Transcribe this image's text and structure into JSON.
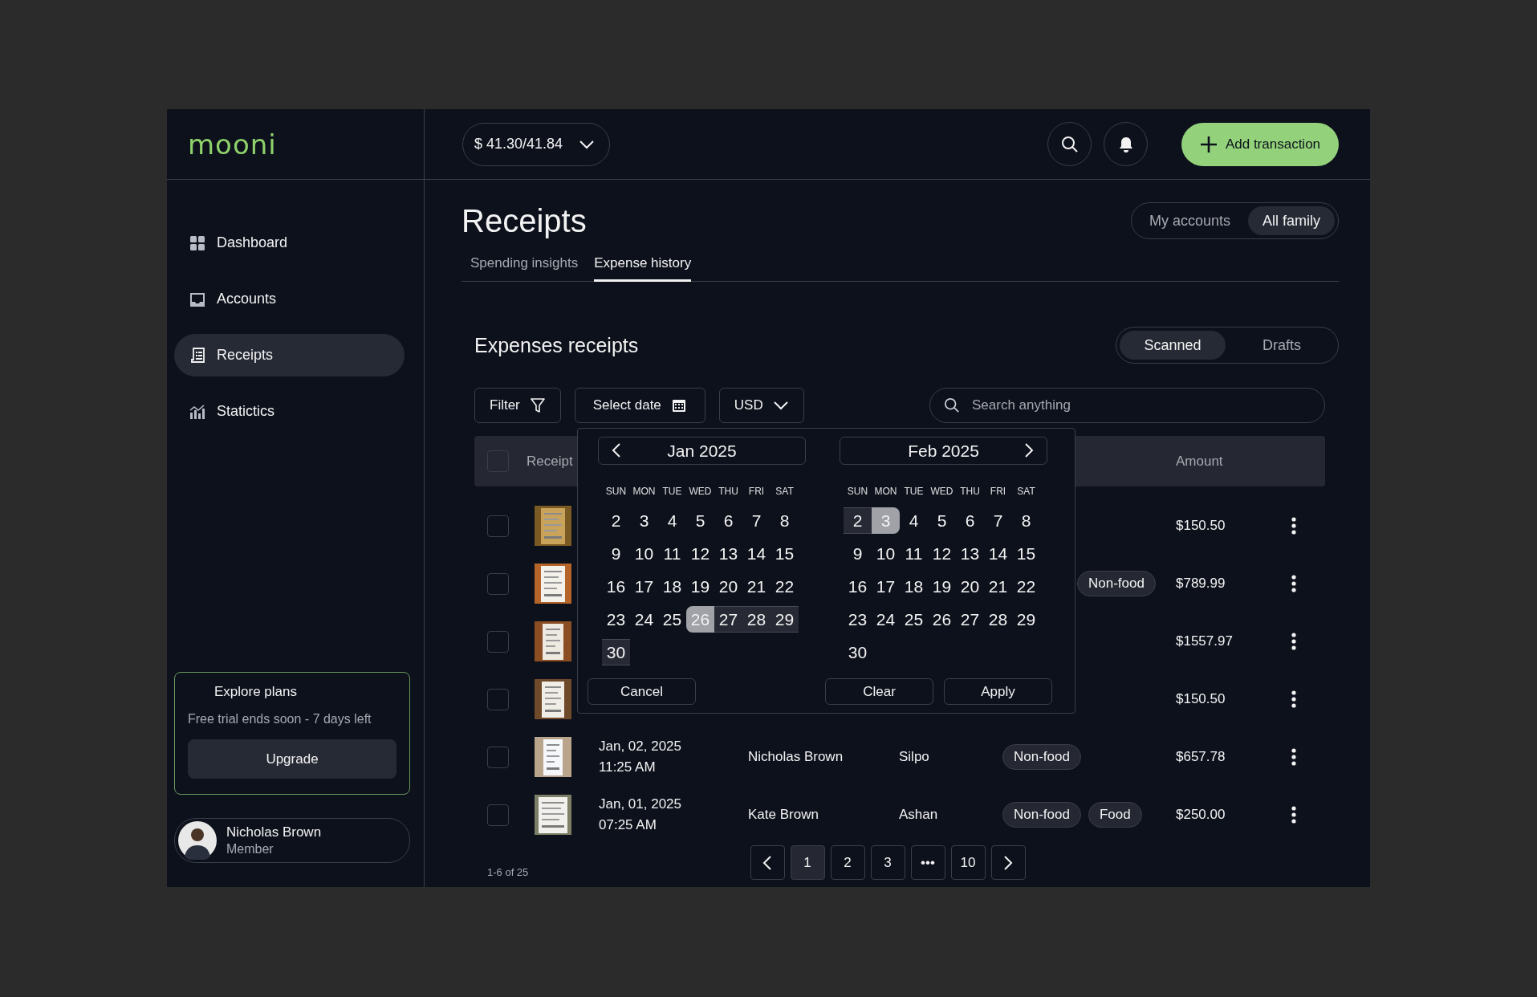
{
  "logo": "mooni",
  "sidebar": {
    "items": [
      {
        "label": "Dashboard",
        "kind": "grid",
        "selected": false
      },
      {
        "label": "Accounts",
        "kind": "tray",
        "selected": false
      },
      {
        "label": "Receipts",
        "kind": "receipt",
        "selected": true
      },
      {
        "label": "Statictics",
        "kind": "chart",
        "selected": false
      }
    ],
    "plan_card": {
      "title": "Explore plans",
      "text": "Free trial ends soon - 7 days left",
      "button": "Upgrade"
    },
    "user": {
      "name": "Nicholas Brown",
      "role": "Member"
    }
  },
  "header": {
    "balance": "$ 41.30/41.84",
    "add_button": "Add transaction"
  },
  "page": {
    "title": "Receipts",
    "scope": [
      {
        "label": "My accounts",
        "selected": false
      },
      {
        "label": "All family",
        "selected": true
      }
    ],
    "tabs": [
      {
        "label": "Spending insights",
        "selected": false
      },
      {
        "label": "Expense history",
        "selected": true
      }
    ]
  },
  "section": {
    "title": "Expenses receipts",
    "views": [
      {
        "label": "Scanned",
        "selected": true
      },
      {
        "label": "Drafts",
        "selected": false
      }
    ],
    "filter_button": "Filter",
    "date_button": "Select date",
    "currency": "USD",
    "search": {
      "placeholder": "Search anything"
    }
  },
  "table": {
    "columns": [
      "Receipt",
      "Amount"
    ],
    "all_checked": false,
    "rows": [
      {
        "checked": false,
        "tags": [],
        "amount": "$150.50"
      },
      {
        "checked": false,
        "first_tag_hidden": true,
        "tags": [
          "Non-food"
        ],
        "amount": "$789.99"
      },
      {
        "checked": false,
        "tags": [],
        "amount": "$1557.97"
      },
      {
        "checked": false,
        "tags": [],
        "amount": "$150.50"
      },
      {
        "checked": false,
        "date": "Jan, 02, 2025",
        "time": "11:25 AM",
        "member": "Nicholas Brown",
        "store": "Silpo",
        "tags": [
          "Non-food"
        ],
        "amount": "$657.78"
      },
      {
        "checked": false,
        "date": "Jan, 01, 2025",
        "time": "07:25 AM",
        "member": "Kate Brown",
        "store": "Ashan",
        "tags": [
          "Non-food",
          "Food"
        ],
        "amount": "$250.00"
      }
    ]
  },
  "pagination": {
    "range": "1-6 of 25",
    "pages": [
      {
        "label": "1",
        "selected": true
      },
      {
        "label": "2",
        "selected": false
      },
      {
        "label": "3",
        "selected": false
      },
      {
        "label": "•••",
        "selected": false
      },
      {
        "label": "10",
        "selected": false
      }
    ]
  },
  "date_picker": {
    "months": [
      {
        "title": "Jan 2025",
        "weekdays": [
          "SUN",
          "MON",
          "TUE",
          "WED",
          "THU",
          "FRI",
          "SAT"
        ],
        "weeks": [
          [
            {
              "day": "2",
              "selected": false,
              "in_range": false
            },
            {
              "day": "3",
              "selected": false,
              "in_range": false
            },
            {
              "day": "4",
              "selected": false,
              "in_range": false
            },
            {
              "day": "5",
              "selected": false,
              "in_range": false
            },
            {
              "day": "6",
              "selected": false,
              "in_range": false
            },
            {
              "day": "7",
              "selected": false,
              "in_range": false
            },
            {
              "day": "8",
              "selected": false,
              "in_range": false
            }
          ],
          [
            {
              "day": "9",
              "selected": false,
              "in_range": false
            },
            {
              "day": "10",
              "selected": false,
              "in_range": false
            },
            {
              "day": "11",
              "selected": false,
              "in_range": false
            },
            {
              "day": "12",
              "selected": false,
              "in_range": false
            },
            {
              "day": "13",
              "selected": false,
              "in_range": false
            },
            {
              "day": "14",
              "selected": false,
              "in_range": false
            },
            {
              "day": "15",
              "selected": false,
              "in_range": false
            }
          ],
          [
            {
              "day": "16",
              "selected": false,
              "in_range": false
            },
            {
              "day": "17",
              "selected": false,
              "in_range": false
            },
            {
              "day": "18",
              "selected": false,
              "in_range": false
            },
            {
              "day": "19",
              "selected": false,
              "in_range": false
            },
            {
              "day": "20",
              "selected": false,
              "in_range": false
            },
            {
              "day": "21",
              "selected": false,
              "in_range": false
            },
            {
              "day": "22",
              "selected": false,
              "in_range": false
            }
          ],
          [
            {
              "day": "23",
              "selected": false,
              "in_range": false
            },
            {
              "day": "24",
              "selected": false,
              "in_range": false
            },
            {
              "day": "25",
              "selected": false,
              "in_range": false
            },
            {
              "day": "26",
              "selected": true,
              "in_range": false
            },
            {
              "day": "27",
              "selected": false,
              "in_range": true
            },
            {
              "day": "28",
              "selected": false,
              "in_range": true
            },
            {
              "day": "29",
              "selected": false,
              "in_range": true
            }
          ],
          [
            {
              "day": "30",
              "selected": false,
              "in_range": true
            }
          ]
        ]
      },
      {
        "title": "Feb 2025",
        "weekdays": [
          "SUN",
          "MON",
          "TUE",
          "WED",
          "THU",
          "FRI",
          "SAT"
        ],
        "weeks": [
          [
            {
              "day": "2",
              "selected": false,
              "in_range": true
            },
            {
              "day": "3",
              "selected": true,
              "in_range": false
            },
            {
              "day": "4",
              "selected": false,
              "in_range": false
            },
            {
              "day": "5",
              "selected": false,
              "in_range": false
            },
            {
              "day": "6",
              "selected": false,
              "in_range": false
            },
            {
              "day": "7",
              "selected": false,
              "in_range": false
            },
            {
              "day": "8",
              "selected": false,
              "in_range": false
            }
          ],
          [
            {
              "day": "9",
              "selected": false,
              "in_range": false
            },
            {
              "day": "10",
              "selected": false,
              "in_range": false
            },
            {
              "day": "11",
              "selected": false,
              "in_range": false
            },
            {
              "day": "12",
              "selected": false,
              "in_range": false
            },
            {
              "day": "13",
              "selected": false,
              "in_range": false
            },
            {
              "day": "14",
              "selected": false,
              "in_range": false
            },
            {
              "day": "15",
              "selected": false,
              "in_range": false
            }
          ],
          [
            {
              "day": "16",
              "selected": false,
              "in_range": false
            },
            {
              "day": "17",
              "selected": false,
              "in_range": false
            },
            {
              "day": "18",
              "selected": false,
              "in_range": false
            },
            {
              "day": "19",
              "selected": false,
              "in_range": false
            },
            {
              "day": "20",
              "selected": false,
              "in_range": false
            },
            {
              "day": "21",
              "selected": false,
              "in_range": false
            },
            {
              "day": "22",
              "selected": false,
              "in_range": false
            }
          ],
          [
            {
              "day": "23",
              "selected": false,
              "in_range": false
            },
            {
              "day": "24",
              "selected": false,
              "in_range": false
            },
            {
              "day": "25",
              "selected": false,
              "in_range": false
            },
            {
              "day": "26",
              "selected": false,
              "in_range": false
            },
            {
              "day": "27",
              "selected": false,
              "in_range": false
            },
            {
              "day": "28",
              "selected": false,
              "in_range": false
            },
            {
              "day": "29",
              "selected": false,
              "in_range": false
            }
          ],
          [
            {
              "day": "30",
              "selected": false,
              "in_range": false
            }
          ]
        ]
      }
    ],
    "cancel": "Cancel",
    "clear": "Clear",
    "apply": "Apply"
  }
}
